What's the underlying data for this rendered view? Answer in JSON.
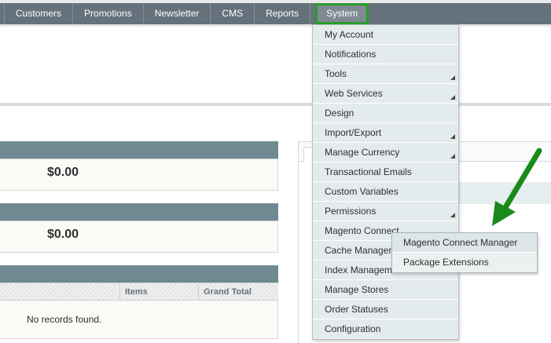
{
  "nav": {
    "items": [
      "Customers",
      "Promotions",
      "Newsletter",
      "CMS",
      "Reports",
      "System"
    ],
    "active": "System"
  },
  "dashboard": {
    "lifetime_sales_value": "$0.00",
    "average_order_value": "$0.00",
    "orders_table": {
      "columns": [
        "Items",
        "Grand Total"
      ],
      "empty_message": "No records found."
    }
  },
  "system_menu": {
    "items": [
      {
        "label": "My Account",
        "has_submenu": false
      },
      {
        "label": "Notifications",
        "has_submenu": false
      },
      {
        "label": "Tools",
        "has_submenu": true
      },
      {
        "label": "Web Services",
        "has_submenu": true
      },
      {
        "label": "Design",
        "has_submenu": false
      },
      {
        "label": "Import/Export",
        "has_submenu": true
      },
      {
        "label": "Manage Currency",
        "has_submenu": true
      },
      {
        "label": "Transactional Emails",
        "has_submenu": false
      },
      {
        "label": "Custom Variables",
        "has_submenu": false
      },
      {
        "label": "Permissions",
        "has_submenu": true
      },
      {
        "label": "Magento Connect",
        "has_submenu": true
      },
      {
        "label": "Cache Management",
        "has_submenu": false
      },
      {
        "label": "Index Management",
        "has_submenu": false
      },
      {
        "label": "Manage Stores",
        "has_submenu": false
      },
      {
        "label": "Order Statuses",
        "has_submenu": false
      },
      {
        "label": "Configuration",
        "has_submenu": false
      }
    ]
  },
  "magento_connect_submenu": {
    "items": [
      "Magento Connect Manager",
      "Package Extensions"
    ]
  },
  "colors": {
    "nav_bar": "#65717b",
    "panel_header": "#6f8992",
    "menu_bg": "#e4ebed",
    "highlight_green": "#2a9b2a"
  }
}
